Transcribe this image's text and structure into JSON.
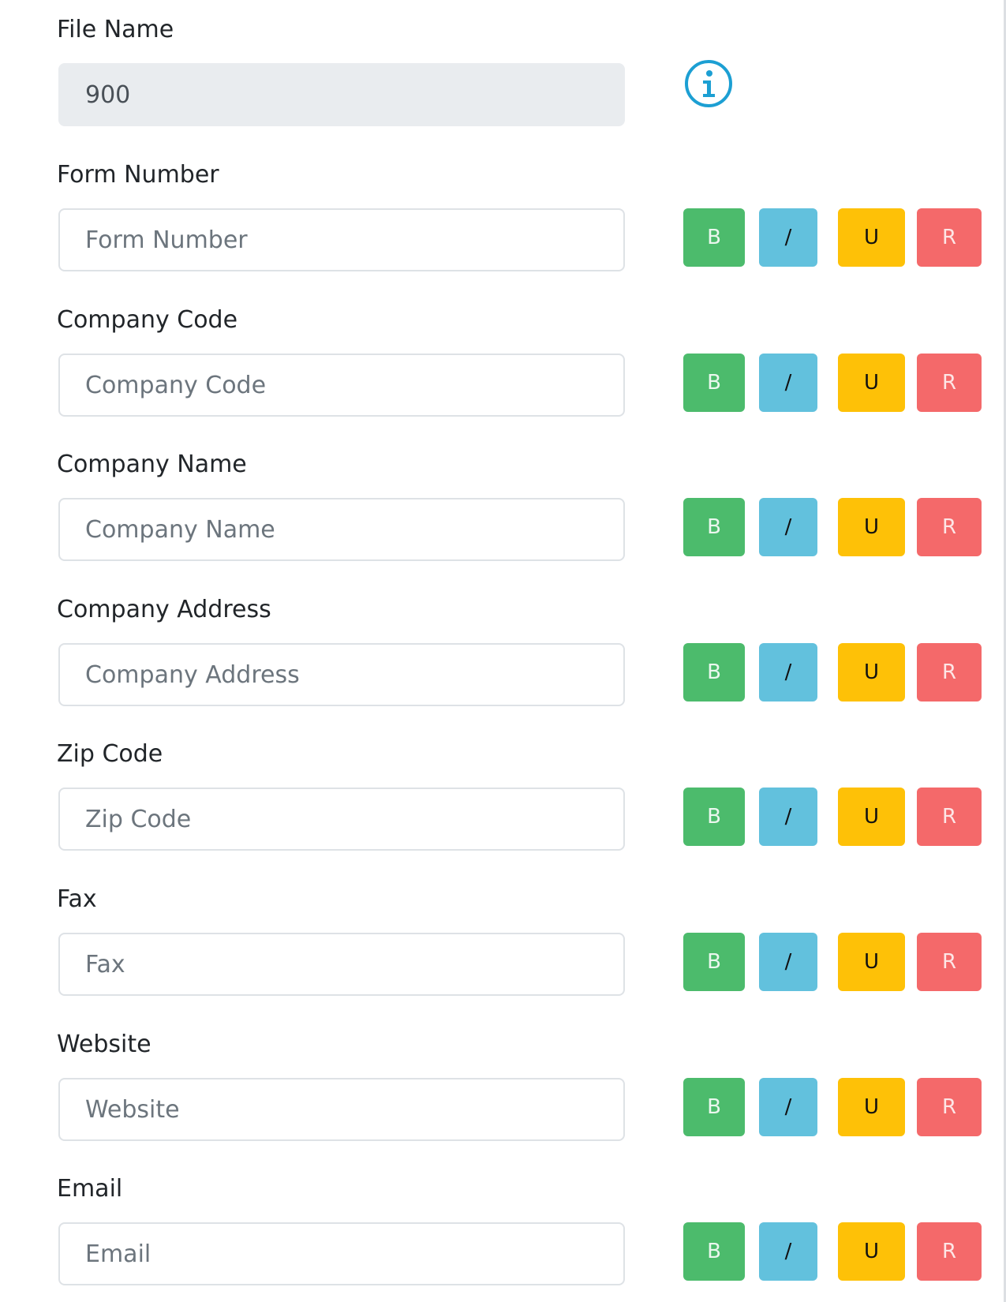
{
  "fields": [
    {
      "label": "File Name",
      "value": "900",
      "placeholder": "",
      "readonly": true
    },
    {
      "label": "Form Number",
      "value": "",
      "placeholder": "Form Number"
    },
    {
      "label": "Company Code",
      "value": "",
      "placeholder": "Company Code"
    },
    {
      "label": "Company Name",
      "value": "",
      "placeholder": "Company Name"
    },
    {
      "label": "Company Address",
      "value": "",
      "placeholder": "Company Address"
    },
    {
      "label": "Zip Code",
      "value": "",
      "placeholder": "Zip Code"
    },
    {
      "label": "Fax",
      "value": "",
      "placeholder": "Fax"
    },
    {
      "label": "Website",
      "value": "",
      "placeholder": "Website"
    },
    {
      "label": "Email",
      "value": "",
      "placeholder": "Email"
    }
  ],
  "format_buttons": {
    "bold": "B",
    "italic": "/",
    "underline": "U",
    "reset": "R"
  },
  "icons": {
    "file_name_info": "info-icon"
  },
  "colors": {
    "bold": "#4cbb6c",
    "italic": "#62c1dd",
    "underline": "#fec107",
    "reset": "#f4696a",
    "info_icon": "#1c9fd3",
    "readonly_bg": "#e9ecef"
  }
}
